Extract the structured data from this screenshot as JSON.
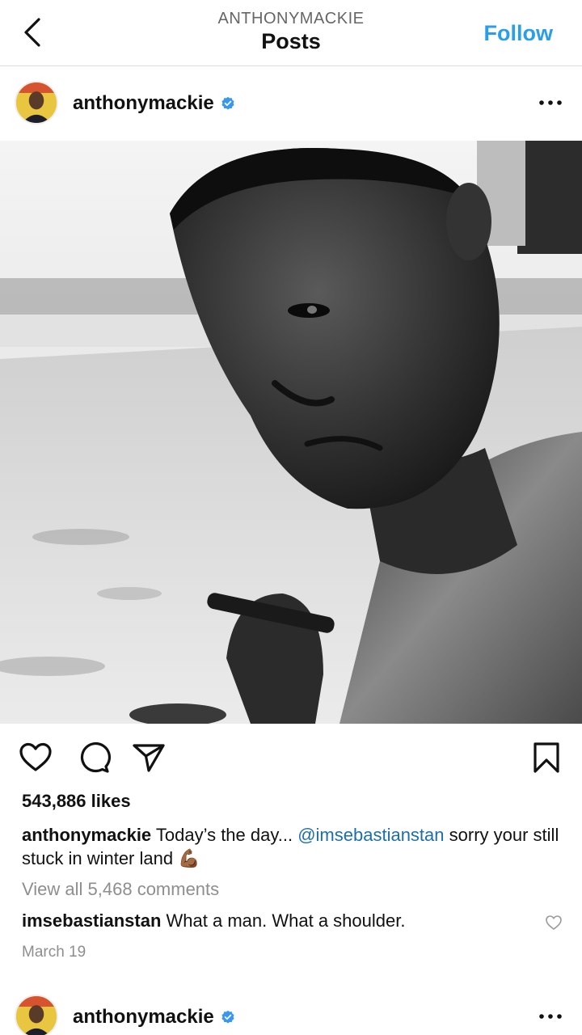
{
  "header": {
    "subtitle": "ANTHONYMACKIE",
    "title": "Posts",
    "follow_label": "Follow"
  },
  "post": {
    "username": "anthonymackie",
    "verified": true,
    "likes": "543,886 likes",
    "caption": {
      "username": "anthonymackie",
      "text_before": "Today’s the day...",
      "mention": "@imsebastianstan",
      "text_after": "sorry your still stuck in winter land",
      "emoji": "💪🏾"
    },
    "view_all_comments": "View all 5,468 comments",
    "top_comment": {
      "username": "imsebastianstan",
      "text": "What a man. What a shoulder."
    },
    "date": "March 19"
  },
  "next_post": {
    "username": "anthonymackie",
    "verified": true
  },
  "icons": {
    "back": "chevron-left-icon",
    "more": "more-horizontal-icon",
    "like": "heart-icon",
    "comment": "comment-bubble-icon",
    "share": "paper-plane-icon",
    "save": "bookmark-icon",
    "verified": "verified-badge-icon"
  },
  "colors": {
    "follow": "#2a9ee8",
    "mention": "#1d6fa5",
    "muted": "#8e8e8e",
    "verified": "#3897f0"
  }
}
